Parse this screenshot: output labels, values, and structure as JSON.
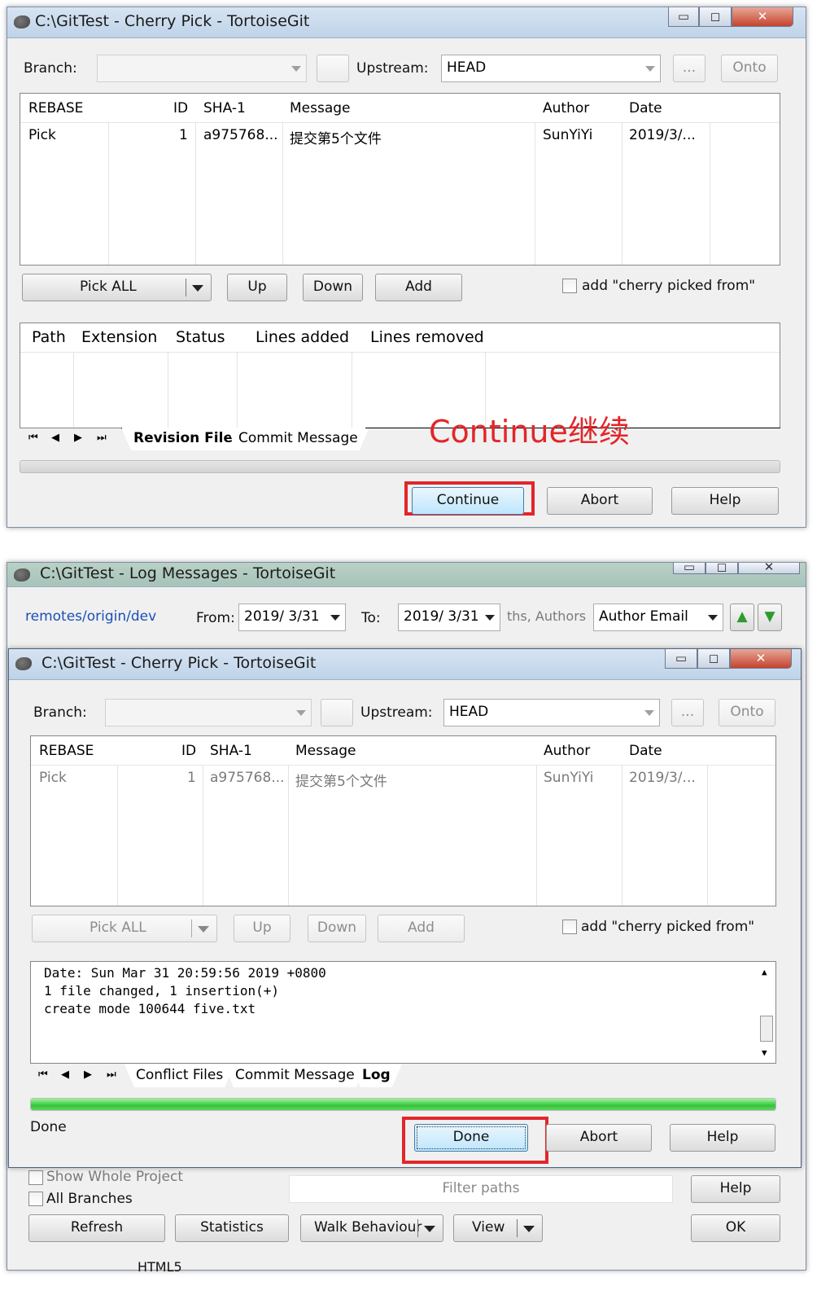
{
  "colors": {
    "highlight": "#e2262a",
    "progress": "#37c23b",
    "link": "#1c4fb5"
  },
  "top_window": {
    "title": "C:\\GitTest - Cherry Pick - TortoiseGit",
    "branch_label": "Branch:",
    "branch_value": "",
    "upstream_label": "Upstream:",
    "upstream_value": "HEAD",
    "ellipsis_label": "...",
    "onto_label": "Onto",
    "columns": [
      "REBASE",
      "ID",
      "SHA-1",
      "Message",
      "Author",
      "Date"
    ],
    "row": {
      "rebase": "Pick",
      "id": "1",
      "sha": "a975768...",
      "message": "提交第5个文件",
      "author": "SunYiYi",
      "date": "2019/3/..."
    },
    "pick_all_label": "Pick ALL",
    "up_label": "Up",
    "down_label": "Down",
    "add_label": "Add",
    "cherry_checkbox_label": "add \"cherry picked from\"",
    "file_columns": [
      "Path",
      "Extension",
      "Status",
      "Lines added",
      "Lines removed"
    ],
    "tabs": [
      "Revision Files",
      "Commit Message"
    ],
    "annotation": "Continue继续",
    "continue_label": "Continue",
    "abort_label": "Abort",
    "help_label": "Help"
  },
  "log_window": {
    "title": "C:\\GitTest - Log Messages - TortoiseGit",
    "branch_link": "remotes/origin/dev",
    "from_label": "From:",
    "from_value": "2019/ 3/31",
    "to_label": "To:",
    "to_value": "2019/ 3/31",
    "filter_hint": "ths, Authors",
    "author_email": "Author Email",
    "show_whole_project": "Show Whole Project",
    "all_branches": "All Branches",
    "filter_paths": "Filter paths",
    "help_label": "Help",
    "refresh_label": "Refresh",
    "statistics_label": "Statistics",
    "walk_label": "Walk Behaviour",
    "view_label": "View",
    "ok_label": "OK",
    "bottom_text": "HTML5"
  },
  "bottom_window": {
    "title": "C:\\GitTest - Cherry Pick - TortoiseGit",
    "branch_label": "Branch:",
    "upstream_label": "Upstream:",
    "upstream_value": "HEAD",
    "ellipsis_label": "...",
    "onto_label": "Onto",
    "columns": [
      "REBASE",
      "ID",
      "SHA-1",
      "Message",
      "Author",
      "Date"
    ],
    "row": {
      "rebase": "Pick",
      "id": "1",
      "sha": "a975768...",
      "message": "提交第5个文件",
      "author": "SunYiYi",
      "date": "2019/3/..."
    },
    "pick_all_label": "Pick ALL",
    "up_label": "Up",
    "down_label": "Down",
    "add_label": "Add",
    "cherry_checkbox_label": "add \"cherry picked from\"",
    "log_lines": [
      "Date: Sun Mar 31 20:59:56 2019 +0800",
      "1 file changed, 1 insertion(+)",
      "create mode 100644 five.txt"
    ],
    "tabs": [
      "Conflict Files",
      "Commit Message",
      "Log"
    ],
    "progress": 1.0,
    "status_text": "Done",
    "done_label": "Done",
    "abort_label": "Abort",
    "help_label": "Help"
  }
}
